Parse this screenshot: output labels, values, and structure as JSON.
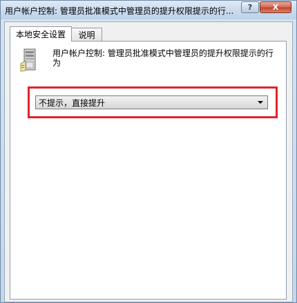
{
  "window": {
    "title": "用户帐户控制: 管理员批准模式中管理员的提升权限提示的行...",
    "help_button": "?",
    "close_button": "X"
  },
  "tabs": [
    {
      "label": "本地安全设置",
      "active": true
    },
    {
      "label": "说明",
      "active": false
    }
  ],
  "policy": {
    "icon": "server-icon",
    "description": "用户帐户控制: 管理员批准模式中管理员的提升权限提示的行为"
  },
  "setting": {
    "selected_value": "不提示，直接提升"
  },
  "colors": {
    "highlight": "#e0222a",
    "close_button": "#c5462b"
  }
}
